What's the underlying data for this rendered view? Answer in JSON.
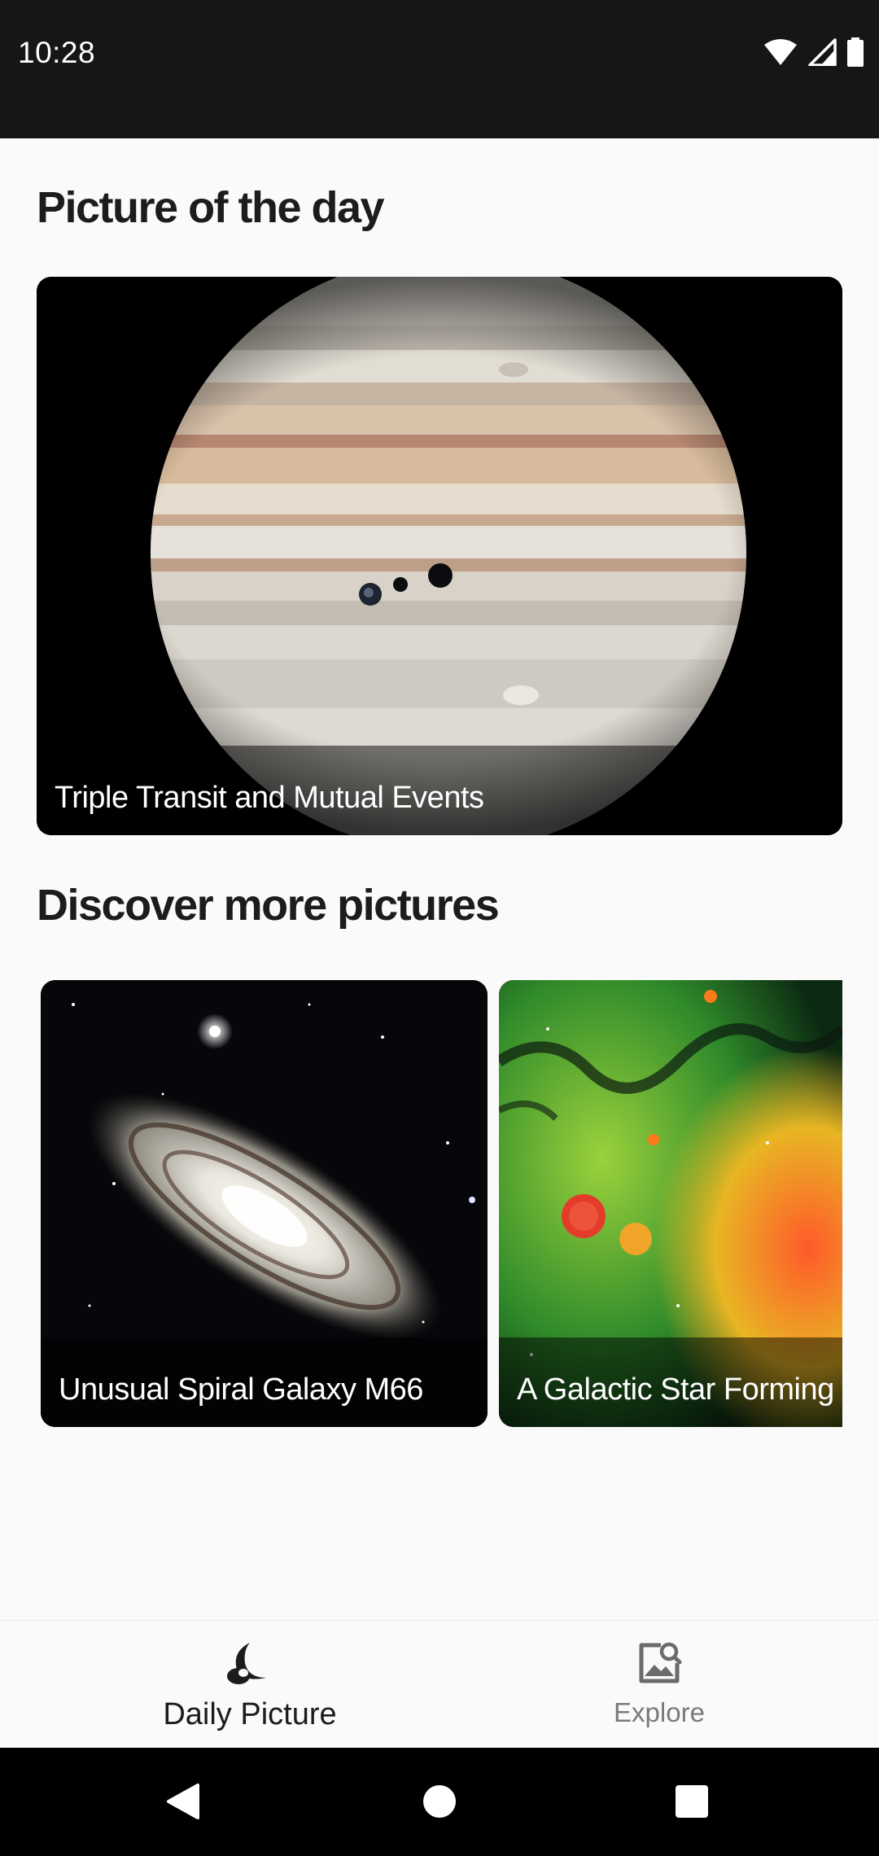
{
  "status_bar": {
    "time": "10:28",
    "icons": [
      "wifi-icon",
      "cell-signal-icon",
      "battery-icon"
    ]
  },
  "sections": {
    "picture_of_the_day": "Picture of the day",
    "discover_more": "Discover more pictures"
  },
  "picture_of_the_day": {
    "caption": "Triple Transit and Mutual Events"
  },
  "discover": [
    {
      "caption": "Unusual Spiral Galaxy M66"
    },
    {
      "caption": "A Galactic Star Forming R"
    }
  ],
  "bottom_nav": {
    "items": [
      {
        "label": "Daily Picture",
        "icon": "moon-icon",
        "selected": true
      },
      {
        "label": "Explore",
        "icon": "image-search-icon",
        "selected": false
      }
    ]
  },
  "system_nav": [
    "back-icon",
    "home-icon",
    "recents-icon"
  ],
  "colors": {
    "status_bar": "#161616",
    "background": "#fafafa",
    "text_primary": "#1c1c1c",
    "text_secondary": "#7a7a7a",
    "system_nav": "#000000"
  }
}
